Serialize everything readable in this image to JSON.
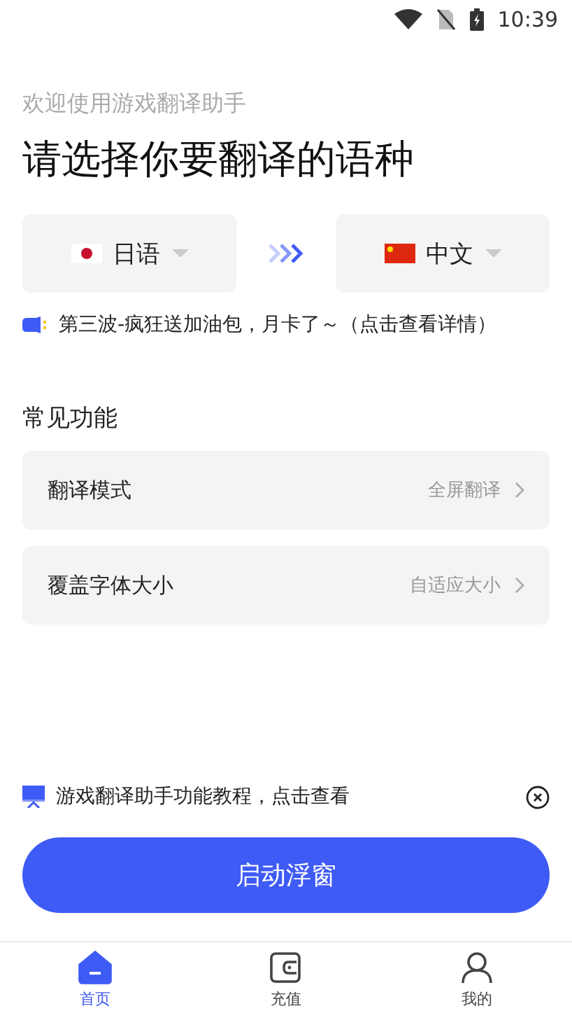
{
  "status_bar": {
    "time": "10:39"
  },
  "subtitle": "欢迎使用游戏翻译助手",
  "title": "请选择你要翻译的语种",
  "languages": {
    "source": {
      "label": "日语",
      "kind": "japan"
    },
    "target": {
      "label": "中文",
      "kind": "china"
    }
  },
  "announcement": "第三波-疯狂送加油包，月卡了～（点击查看详情）",
  "section_title": "常见功能",
  "settings": [
    {
      "label": "翻译模式",
      "value": "全屏翻译"
    },
    {
      "label": "覆盖字体大小",
      "value": "自适应大小"
    }
  ],
  "tutorial": "游戏翻译助手功能教程，点击查看",
  "start_button": "启动浮窗",
  "nav": [
    {
      "label": "首页",
      "kind": "home",
      "selected": true
    },
    {
      "label": "充值",
      "kind": "wallet",
      "selected": false
    },
    {
      "label": "我的",
      "kind": "person",
      "selected": false
    }
  ]
}
